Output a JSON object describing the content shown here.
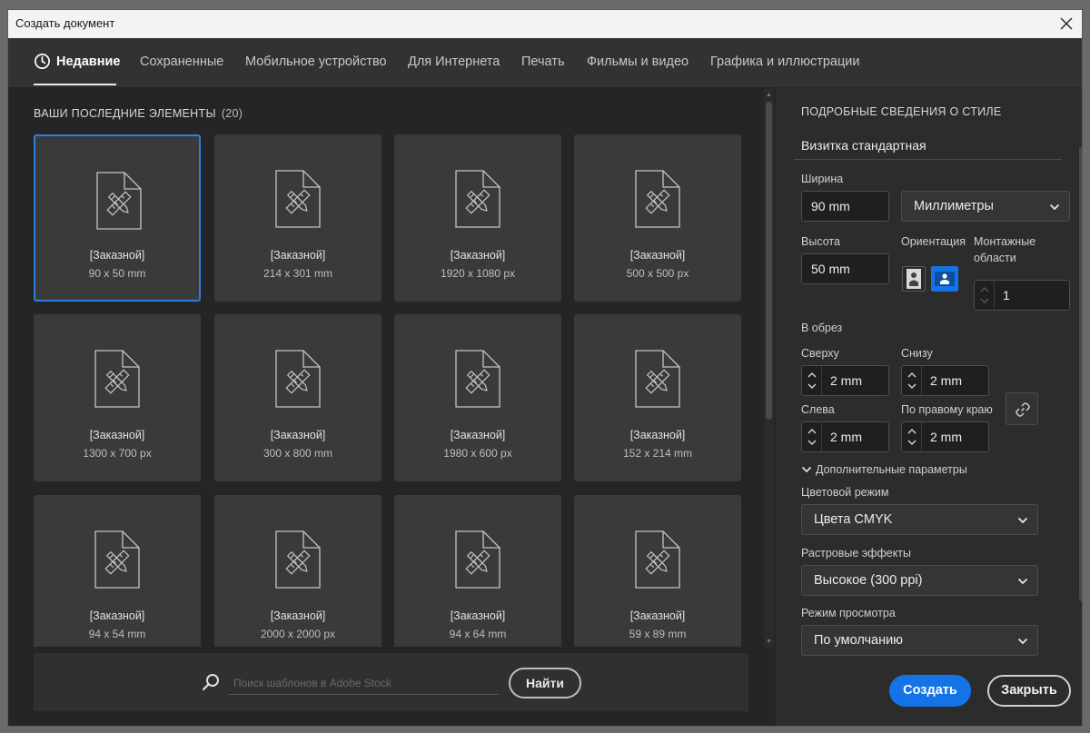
{
  "window": {
    "title": "Создать документ"
  },
  "tabs": [
    {
      "label": "Недавние",
      "active": true
    },
    {
      "label": "Сохраненные"
    },
    {
      "label": "Мобильное устройство"
    },
    {
      "label": "Для Интернета"
    },
    {
      "label": "Печать"
    },
    {
      "label": "Фильмы и видео"
    },
    {
      "label": "Графика и иллюстрации"
    }
  ],
  "recent": {
    "title": "ВАШИ ПОСЛЕДНИЕ ЭЛЕМЕНТЫ",
    "count": "(20)",
    "items": [
      {
        "name": "[Заказной]",
        "size": "90 x 50 mm",
        "selected": true
      },
      {
        "name": "[Заказной]",
        "size": "214 x 301 mm"
      },
      {
        "name": "[Заказной]",
        "size": "1920 x 1080 px"
      },
      {
        "name": "[Заказной]",
        "size": "500 x 500 px"
      },
      {
        "name": "[Заказной]",
        "size": "1300 x 700 px"
      },
      {
        "name": "[Заказной]",
        "size": "300 x 800 mm"
      },
      {
        "name": "[Заказной]",
        "size": "1980 x 600 px"
      },
      {
        "name": "[Заказной]",
        "size": "152 x 214 mm"
      },
      {
        "name": "[Заказной]",
        "size": "94 x 54 mm"
      },
      {
        "name": "[Заказной]",
        "size": "2000 x 2000 px"
      },
      {
        "name": "[Заказной]",
        "size": "94 x 64 mm"
      },
      {
        "name": "[Заказной]",
        "size": "59 x 89 mm"
      }
    ]
  },
  "search": {
    "placeholder": "Поиск шаблонов в Adobe Stock",
    "button": "Найти"
  },
  "details": {
    "heading": "ПОДРОБНЫЕ СВЕДЕНИЯ О СТИЛЕ",
    "preset_name": "Визитка стандартная",
    "width_label": "Ширина",
    "width_value": "90 mm",
    "units": "Миллиметры",
    "height_label": "Высота",
    "height_value": "50 mm",
    "orientation_label": "Ориентация",
    "orientation_selected": "landscape",
    "artboards_label_1": "Монтажные",
    "artboards_label_2": "области",
    "artboards_value": "1",
    "bleed_label": "В обрез",
    "bleed_top_label": "Сверху",
    "bleed_top": "2 mm",
    "bleed_bottom_label": "Снизу",
    "bleed_bottom": "2 mm",
    "bleed_left_label": "Слева",
    "bleed_left": "2 mm",
    "bleed_right_label": "По правому краю",
    "bleed_right": "2 mm",
    "advanced_label": "Дополнительные параметры",
    "color_mode_label": "Цветовой режим",
    "color_mode": "Цвета CMYK",
    "raster_label": "Растровые эффекты",
    "raster": "Высокое (300 ppi)",
    "preview_label": "Режим просмотра",
    "preview": "По умолчанию"
  },
  "actions": {
    "create": "Создать",
    "close": "Закрыть"
  },
  "colors": {
    "accent": "#1473e6",
    "selected_border": "#2b7de0",
    "background": "#252525",
    "panel": "#2c2c2c",
    "card": "#3a3a3a"
  }
}
